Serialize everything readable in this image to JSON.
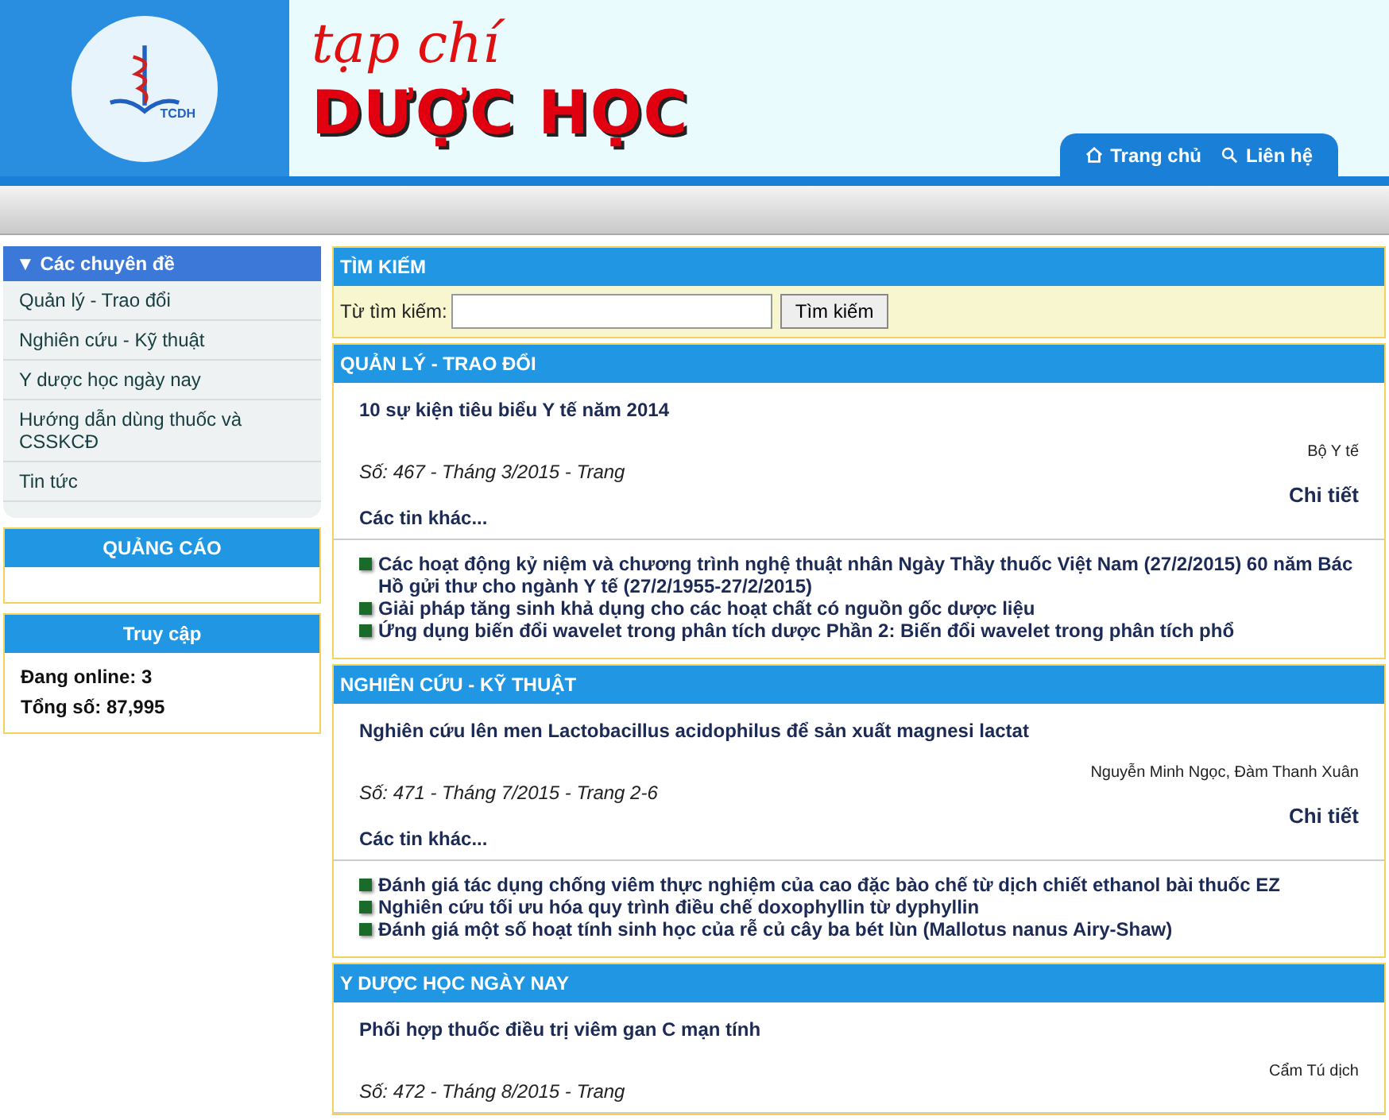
{
  "header": {
    "logo_text": "TCDH",
    "tagline": "tạp chí",
    "title": "DƯỢC HỌC",
    "nav": [
      {
        "label": "Trang chủ",
        "kind": "home"
      },
      {
        "label": "Liên hệ",
        "kind": "search"
      }
    ]
  },
  "sidebar": {
    "menu_title": "▼ Các chuyên đề",
    "items": [
      "Quản lý - Trao đổi",
      "Nghiên cứu - Kỹ thuật",
      "Y dược học ngày nay",
      "Hướng dẫn dùng thuốc và CSSKCĐ",
      "Tin tức"
    ],
    "ads_title": "QUẢNG CÁO",
    "stats_title": "Truy cập",
    "stats": [
      "Đang online: 3",
      "Tổng số: 87,995"
    ]
  },
  "search": {
    "title": "TÌM KIẾM",
    "label": "Từ tìm kiếm:",
    "button": "Tìm kiếm"
  },
  "sections": [
    {
      "title": "QUẢN LÝ - TRAO ĐỔI",
      "headline": "10 sự kiện tiêu biểu Y tế năm 2014",
      "author": "Bộ Y tế",
      "issue": "Số: 467 - Tháng 3/2015 - Trang",
      "detail": "Chi tiết",
      "more": "Các tin khác...",
      "links": [
        "Các hoạt động kỷ niệm và chương trình nghệ thuật nhân Ngày Thầy thuốc Việt Nam (27/2/2015) 60 năm Bác Hồ gửi thư cho ngành Y tế (27/2/1955-27/2/2015)",
        "Giải pháp tăng sinh khả dụng cho các hoạt chất có nguồn gốc dược liệu",
        "Ứng dụng biến đổi wavelet trong phân tích dược Phần 2: Biến đổi wavelet trong phân tích phổ"
      ]
    },
    {
      "title": "NGHIÊN CỨU - KỸ THUẬT",
      "headline": "Nghiên cứu lên men Lactobacillus acidophilus để sản xuất magnesi lactat",
      "author": "Nguyễn Minh Ngọc, Đàm Thanh Xuân",
      "issue": "Số: 471 - Tháng 7/2015 - Trang 2-6",
      "detail": "Chi tiết",
      "more": "Các tin khác...",
      "links": [
        "Đánh giá tác dụng chống viêm thực nghiệm của cao đặc bào chế từ dịch chiết ethanol bài thuốc EZ",
        "Nghiên cứu tối ưu hóa quy trình điều chế doxophyllin từ dyphyllin",
        "Đánh giá một số hoạt tính sinh học của rễ củ cây ba bét lùn (Mallotus nanus Airy-Shaw)"
      ]
    },
    {
      "title": "Y DƯỢC HỌC NGÀY NAY",
      "headline": "Phối hợp thuốc điều trị viêm gan C mạn tính",
      "author": "Cẩm Tú dịch",
      "issue": "Số: 472 - Tháng 8/2015 - Trang"
    }
  ]
}
